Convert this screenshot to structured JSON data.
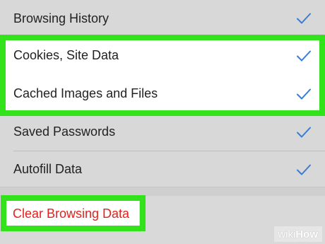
{
  "settings_list": {
    "items": [
      {
        "label": "Browsing History",
        "checked": true
      },
      {
        "label": "Cookies, Site Data",
        "checked": true
      },
      {
        "label": "Cached Images and Files",
        "checked": true
      },
      {
        "label": "Saved Passwords",
        "checked": true
      },
      {
        "label": "Autofill Data",
        "checked": true
      }
    ]
  },
  "actions": {
    "clear_label": "Clear Browsing Data"
  },
  "watermark": {
    "prefix": "wiki",
    "suffix": "How"
  },
  "colors": {
    "checkmark": "#3a7bd5",
    "highlight": "#32e21b",
    "destructive": "#e0231f"
  },
  "icons": {
    "check": "checkmark-icon"
  }
}
